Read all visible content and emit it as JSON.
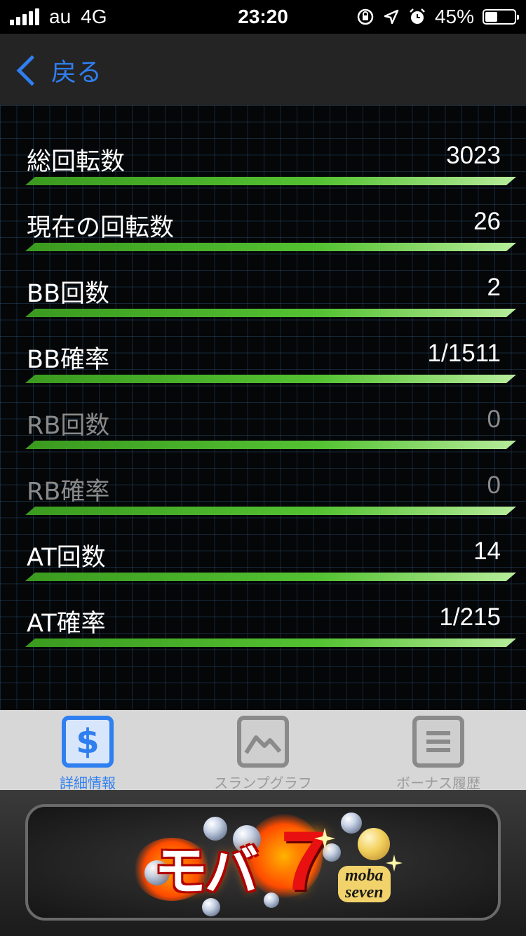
{
  "status_bar": {
    "carrier": "au",
    "network": "4G",
    "time": "23:20",
    "battery": "45%",
    "battery_level": 0.45,
    "icons": [
      "rotation-lock-icon",
      "location-icon",
      "alarm-icon"
    ]
  },
  "nav": {
    "back_label": "戻る"
  },
  "stats": [
    {
      "label": "総回転数",
      "value": "3023",
      "dimmed": false
    },
    {
      "label": "現在の回転数",
      "value": "26",
      "dimmed": false
    },
    {
      "label": "BB回数",
      "value": "2",
      "dimmed": false
    },
    {
      "label": "BB確率",
      "value": "1/1511",
      "dimmed": false
    },
    {
      "label": "RB回数",
      "value": "0",
      "dimmed": true
    },
    {
      "label": "RB確率",
      "value": "0",
      "dimmed": true
    },
    {
      "label": "AT回数",
      "value": "14",
      "dimmed": false
    },
    {
      "label": "AT確率",
      "value": "1/215",
      "dimmed": false
    }
  ],
  "tabs": [
    {
      "label": "詳細情報",
      "icon": "dollar-icon",
      "active": true
    },
    {
      "label": "スランプグラフ",
      "icon": "graph-icon",
      "active": false
    },
    {
      "label": "ボーナス履歴",
      "icon": "list-icon",
      "active": false
    }
  ],
  "ad": {
    "logo_text": "モバ",
    "logo_number": "7",
    "logo_sub_1": "moba",
    "logo_sub_2": "seven"
  },
  "colors": {
    "accent": "#2f7ff0",
    "bar_green": "#54c232",
    "nav_bg": "#242424",
    "tabbar_bg": "#d7d7d7"
  }
}
